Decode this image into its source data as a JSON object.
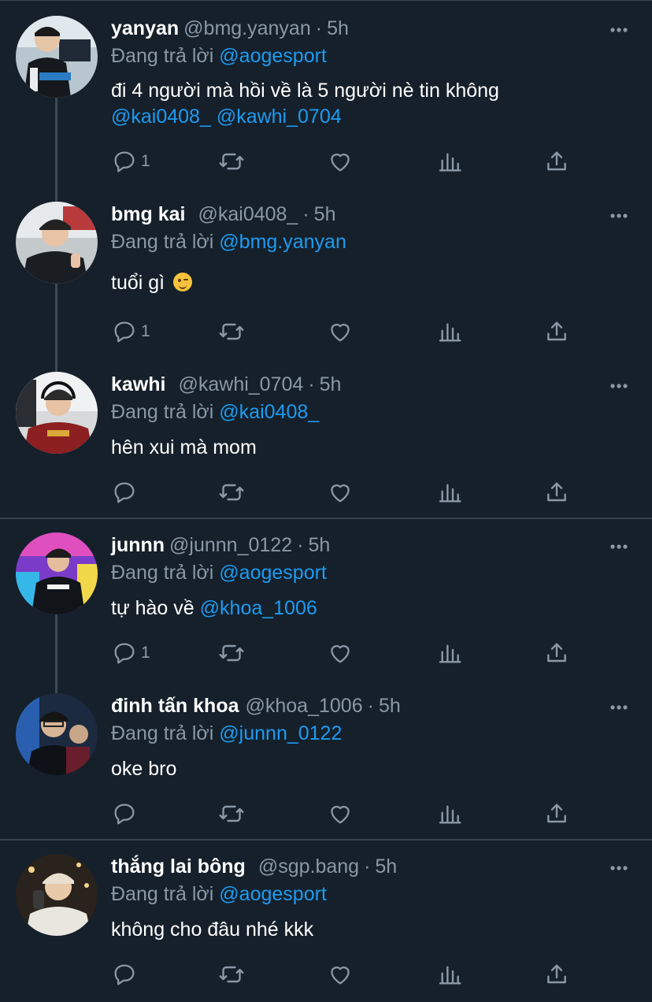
{
  "reply_prefix": "Đang trả lời",
  "tweets": [
    {
      "name": "yanyan",
      "handle": "@bmg.yanyan",
      "time": "5h",
      "reply_to": "@aogesport",
      "text_line1": "đi 4 người mà hồi về là 5 người nè tin không",
      "mention1": "@kai0408_",
      "mention2": "@kawhi_0704",
      "reply_count": "1"
    },
    {
      "name": "bmg kai",
      "handle": "@kai0408_",
      "time": "5h",
      "reply_to": "@bmg.yanyan",
      "text": "tuổi gì",
      "emoji": "winking-face",
      "reply_count": "1"
    },
    {
      "name": "kawhi",
      "handle": "@kawhi_0704",
      "time": "5h",
      "reply_to": "@kai0408_",
      "text": "hên xui mà mom"
    },
    {
      "name": "junnn",
      "handle": "@junnn_0122",
      "time": "5h",
      "reply_to": "@aogesport",
      "text": "tự hào về",
      "mention": "@khoa_1006",
      "reply_count": "1"
    },
    {
      "name": "đinh tấn khoa",
      "handle": "@khoa_1006",
      "time": "5h",
      "reply_to": "@junnn_0122",
      "text": "oke bro"
    },
    {
      "name": "thắng lai bông",
      "handle": "@sgp.bang",
      "time": "5h",
      "reply_to": "@aogesport",
      "text": "không cho đâu nhé kkk"
    }
  ],
  "colors": {
    "background": "#15202b",
    "secondary_text": "#8b98a5",
    "mention": "#1d9bf0",
    "divider": "#38444d"
  }
}
